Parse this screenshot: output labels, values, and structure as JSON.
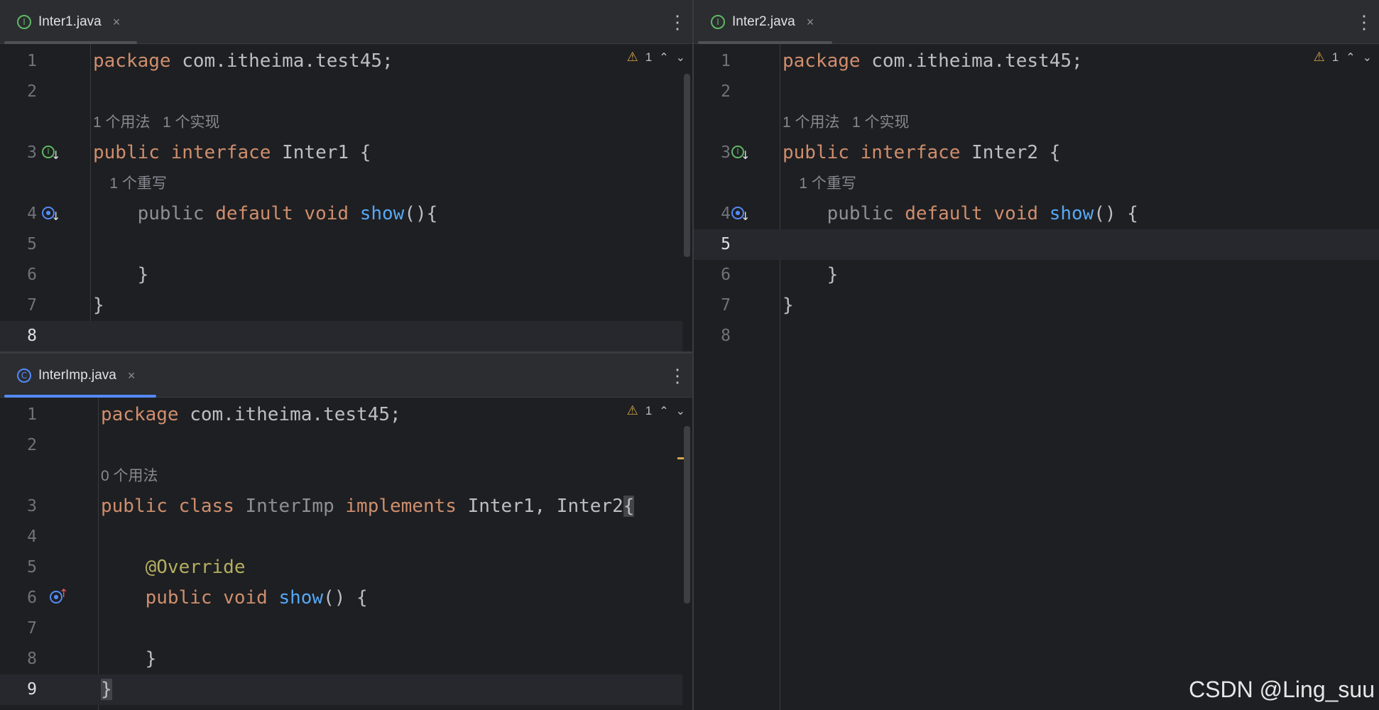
{
  "panes": {
    "left_top": {
      "tab": {
        "icon": "interface-icon",
        "icon_glyph": "I",
        "label": "Inter1.java",
        "close": "×"
      },
      "menu": "⋮",
      "inspection": {
        "count": "1"
      },
      "lines": [
        {
          "n": "1",
          "tokens": [
            [
              "kw",
              "package "
            ],
            [
              "tx",
              "com.itheima.test45;"
            ]
          ]
        },
        {
          "n": "2",
          "tokens": []
        },
        {
          "hint": "1 个用法   1 个实现"
        },
        {
          "n": "3",
          "gutter": "implemented-interface-icon",
          "tokens": [
            [
              "kw",
              "public "
            ],
            [
              "kw",
              "interface "
            ],
            [
              "tx",
              "Inter1 {"
            ]
          ]
        },
        {
          "hint": "    1 个重写"
        },
        {
          "n": "4",
          "gutter": "overridden-method-icon",
          "tokens": [
            [
              "dim",
              "    public "
            ],
            [
              "kw",
              "default "
            ],
            [
              "kw",
              "void "
            ],
            [
              "fn",
              "show"
            ],
            [
              "tx",
              "(){"
            ]
          ]
        },
        {
          "n": "5",
          "tokens": []
        },
        {
          "n": "6",
          "tokens": [
            [
              "tx",
              "    }"
            ]
          ]
        },
        {
          "n": "7",
          "tokens": [
            [
              "tx",
              "}"
            ]
          ]
        },
        {
          "n": "8",
          "tokens": [],
          "current": true
        }
      ]
    },
    "left_bottom": {
      "tab": {
        "icon": "class-icon",
        "icon_glyph": "C",
        "label": "InterImp.java",
        "close": "×"
      },
      "menu": "⋮",
      "inspection": {
        "count": "1"
      },
      "lines": [
        {
          "n": "1",
          "tokens": [
            [
              "kw",
              "package "
            ],
            [
              "tx",
              "com.itheima.test45;"
            ]
          ]
        },
        {
          "n": "2",
          "tokens": []
        },
        {
          "hint": "0 个用法"
        },
        {
          "n": "3",
          "tokens": [
            [
              "kw",
              "public "
            ],
            [
              "kw",
              "class "
            ],
            [
              "dim",
              "InterImp "
            ],
            [
              "kw",
              "implements "
            ],
            [
              "tx",
              "Inter1, Inter2"
            ],
            [
              "brace",
              "{"
            ]
          ]
        },
        {
          "n": "4",
          "tokens": []
        },
        {
          "n": "5",
          "tokens": [
            [
              "an",
              "    @Override"
            ]
          ]
        },
        {
          "n": "6",
          "gutter": "implementing-method-icon",
          "tokens": [
            [
              "kw",
              "    public "
            ],
            [
              "kw",
              "void "
            ],
            [
              "fn",
              "show"
            ],
            [
              "tx",
              "() {"
            ]
          ]
        },
        {
          "n": "7",
          "tokens": []
        },
        {
          "n": "8",
          "tokens": [
            [
              "tx",
              "    }"
            ]
          ]
        },
        {
          "n": "9",
          "tokens": [
            [
              "brace",
              "}"
            ]
          ],
          "current": true
        }
      ]
    },
    "right": {
      "tab": {
        "icon": "interface-icon",
        "icon_glyph": "I",
        "label": "Inter2.java",
        "close": "×"
      },
      "menu": "⋮",
      "inspection": {
        "count": "1"
      },
      "lines": [
        {
          "n": "1",
          "tokens": [
            [
              "kw",
              "package "
            ],
            [
              "tx",
              "com.itheima.test45;"
            ]
          ]
        },
        {
          "n": "2",
          "tokens": []
        },
        {
          "hint": "1 个用法   1 个实现"
        },
        {
          "n": "3",
          "gutter": "implemented-interface-icon",
          "tokens": [
            [
              "kw",
              "public "
            ],
            [
              "kw",
              "interface "
            ],
            [
              "tx",
              "Inter2 {"
            ]
          ]
        },
        {
          "hint": "    1 个重写"
        },
        {
          "n": "4",
          "gutter": "overridden-method-icon",
          "tokens": [
            [
              "dim",
              "    public "
            ],
            [
              "kw",
              "default "
            ],
            [
              "kw",
              "void "
            ],
            [
              "fn",
              "show"
            ],
            [
              "tx",
              "() {"
            ]
          ]
        },
        {
          "n": "5",
          "tokens": [],
          "current": true
        },
        {
          "n": "6",
          "tokens": [
            [
              "tx",
              "    }"
            ]
          ]
        },
        {
          "n": "7",
          "tokens": [
            [
              "tx",
              "}"
            ]
          ]
        },
        {
          "n": "8",
          "tokens": []
        }
      ]
    }
  },
  "watermark": "CSDN @Ling_suu",
  "colors": {
    "keyword": "#cf8e6d",
    "text": "#bcbec4",
    "function": "#56a8f5",
    "annotation": "#b3ae60",
    "warning": "#d7a64a",
    "active_tab": "#548af7"
  }
}
